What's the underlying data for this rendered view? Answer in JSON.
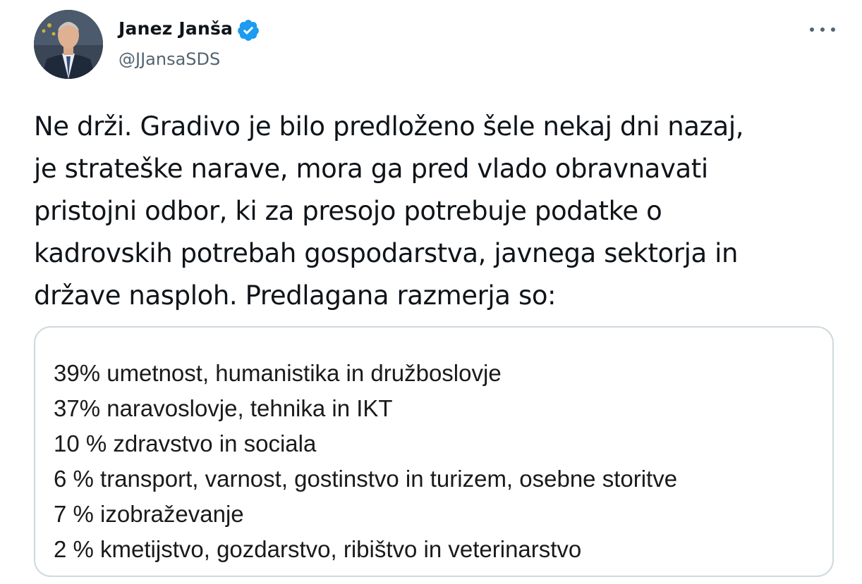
{
  "author": {
    "name": "Janez Janša",
    "handle": "@JJansaSDS",
    "verified": true,
    "avatar_icon": "profile-photo"
  },
  "menu": {
    "icon": "more-horizontal-icon"
  },
  "tweet": {
    "text": "Ne drži. Gradivo je bilo predloženo šele nekaj dni nazaj,\nje strateške narave, mora ga pred vlado obravnavati\npristojni odbor, ki za presojo potrebuje podatke o\nkadrovskih potrebah gospodarstva, javnega sektorja in\ndržave nasploh. Predlagana razmerja so:"
  },
  "media": {
    "lines": [
      "39% umetnost, humanistika in družboslovje",
      "37% naravoslovje, tehnika in IKT",
      "10 % zdravstvo in sociala",
      "6 % transport, varnost, gostinstvo in turizem, osebne storitve",
      "7 % izobraževanje",
      "2 % kmetijstvo, gozdarstvo, ribištvo in veterinarstvo"
    ]
  },
  "colors": {
    "verified_badge": "#1d9bf0",
    "secondary_text": "#536471",
    "card_border": "#cfd9de"
  }
}
